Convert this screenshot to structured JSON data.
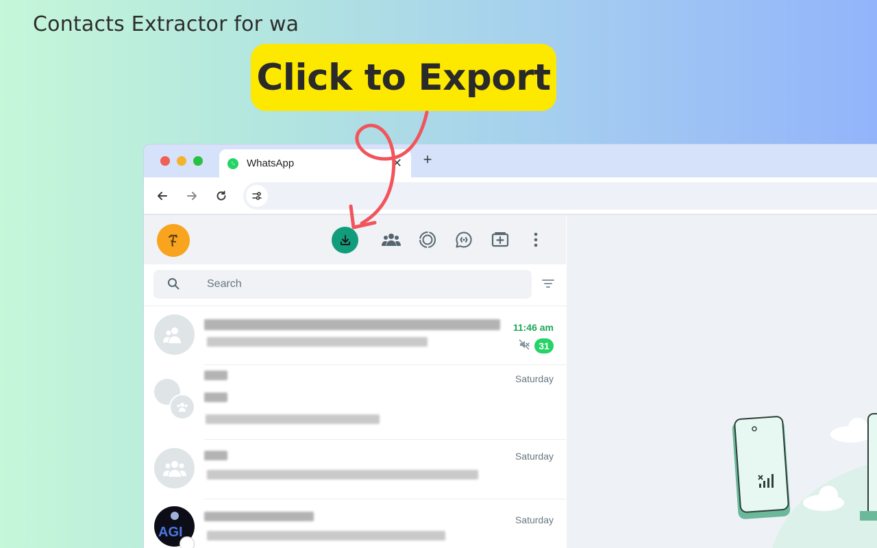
{
  "page": {
    "title": "Contacts Extractor for wa",
    "callout": "Click to Export"
  },
  "browser": {
    "tab_title": "WhatsApp",
    "tab_close": "✕",
    "new_tab": "+"
  },
  "whatsapp": {
    "search_placeholder": "Search",
    "chats": [
      {
        "time": "11:46 am",
        "unread_count": "31",
        "muted": true
      },
      {
        "time": "Saturday"
      },
      {
        "time": "Saturday"
      },
      {
        "time": "Saturday"
      }
    ]
  },
  "colors": {
    "accent_green": "#25d366",
    "export_button": "#119d7b",
    "callout_yellow": "#fde800",
    "arrow_red": "#f1555b"
  },
  "icons": [
    "back-icon",
    "forward-icon",
    "reload-icon",
    "site-settings-icon",
    "download-icon",
    "communities-icon",
    "status-icon",
    "channels-icon",
    "new-chat-icon",
    "menu-icon",
    "search-icon",
    "filter-icon",
    "group-icon",
    "mute-icon"
  ]
}
